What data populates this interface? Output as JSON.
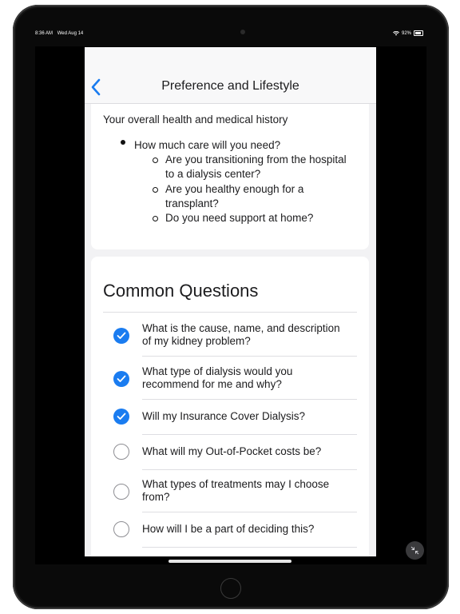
{
  "status_bar": {
    "time": "8:36 AM",
    "date": "Wed Aug 14",
    "battery": "92%"
  },
  "nav": {
    "title": "Preference and Lifestyle",
    "back_icon": "chevron-left-icon"
  },
  "health_section": {
    "heading": "Your overall health and medical history",
    "bullet": "How much care will you need?",
    "sub_items": [
      {
        "line1": "Are you transitioning from the hospital",
        "line2": "to a dialysis center?"
      },
      {
        "line1": "Are you healthy enough for a",
        "line2": "transplant?"
      },
      {
        "line1": "Do you need support at home?",
        "line2": ""
      }
    ]
  },
  "common_questions": {
    "title": "Common Questions",
    "items": [
      {
        "line1": "What is the cause, name, and description",
        "line2": "of my kidney problem?",
        "checked": true
      },
      {
        "line1": "What type of dialysis would you",
        "line2": "recommend for me and why?",
        "checked": true
      },
      {
        "line1": "Will my Insurance Cover Dialysis?",
        "line2": "",
        "checked": true
      },
      {
        "line1": "What will my Out-of-Pocket costs be?",
        "line2": "",
        "checked": false
      },
      {
        "line1": "What types of treatments may I choose",
        "line2": "from?",
        "checked": false
      },
      {
        "line1": "How will I be a part of deciding this?",
        "line2": "",
        "checked": false
      }
    ]
  },
  "colors": {
    "accent": "#1a7cf0",
    "background": "#f2f2f4",
    "card": "#ffffff"
  },
  "icons": {
    "checked": "checkmark-circle-filled-icon",
    "unchecked": "circle-outline-icon",
    "fab": "collapse-arrows-icon"
  }
}
